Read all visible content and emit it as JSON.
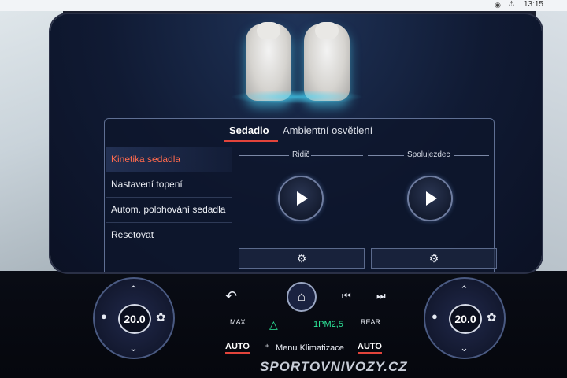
{
  "status": {
    "time": "13:15",
    "alert_icon": "alert-icon",
    "camera_icon": "camera-icon"
  },
  "tabs": {
    "active": "Sedadlo",
    "inactive": "Ambientní osvětlení"
  },
  "menu": {
    "items": [
      {
        "label": "Kinetika sedadla"
      },
      {
        "label": "Nastavení topení"
      },
      {
        "label": "Autom. polohování sedadla"
      },
      {
        "label": "Resetovat"
      }
    ]
  },
  "columns": {
    "driver": "Řidič",
    "passenger": "Spolujezdec"
  },
  "climate": {
    "temp_left": "20.0",
    "temp_right": "20.0",
    "pm_label": "1PM2,5",
    "menu_label": "Menu Klimatizace",
    "auto_left": "AUTO",
    "auto_right": "AUTO",
    "max_label": "MAX",
    "rear_label": "REAR"
  },
  "colors": {
    "accent": "#e2443b",
    "active_menu": "#ff6a4d",
    "seat_glow": "#46dcff",
    "pm_green": "#2ee89a"
  },
  "watermark": "SPORTOVNIVOZY.CZ"
}
